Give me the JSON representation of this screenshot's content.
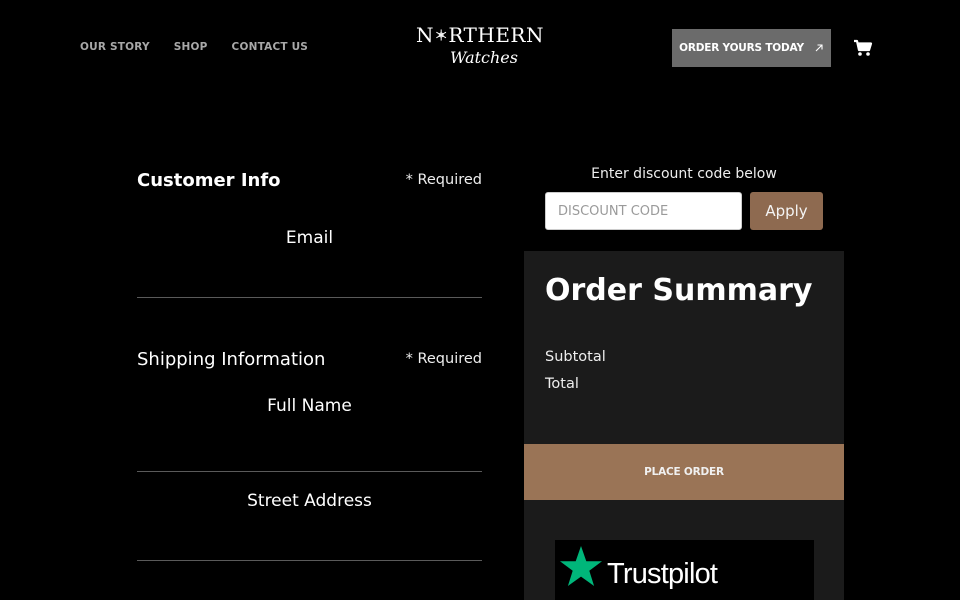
{
  "nav": {
    "items": [
      {
        "label": "OUR STORY"
      },
      {
        "label": "SHOP"
      },
      {
        "label": "CONTACT US"
      }
    ]
  },
  "logo": {
    "line1_left": "N",
    "line1_right": "RTHERN",
    "line2": "Watches"
  },
  "header": {
    "cta_label": "ORDER YOURS TODAY",
    "cta_icon": "arrow-up-right-icon",
    "cart_icon": "cart-icon"
  },
  "customer_info": {
    "title": "Customer Info",
    "required": "* Required",
    "email_label": "Email"
  },
  "shipping": {
    "title": "Shipping Information",
    "required": "* Required",
    "full_name_label": "Full Name",
    "street_label": "Street Address"
  },
  "discount": {
    "label": "Enter discount code below",
    "placeholder": "DISCOUNT CODE",
    "apply_label": "Apply"
  },
  "summary": {
    "title": "Order Summary",
    "subtotal_label": "Subtotal",
    "total_label": "Total",
    "place_order_label": "PLACE ORDER"
  },
  "trustpilot": {
    "label": "Trustpilot",
    "star_color": "#00b67a"
  },
  "colors": {
    "accent": "#9a7456",
    "cta_bg": "#6b6b6b",
    "panel_bg": "#1b1b1b"
  }
}
